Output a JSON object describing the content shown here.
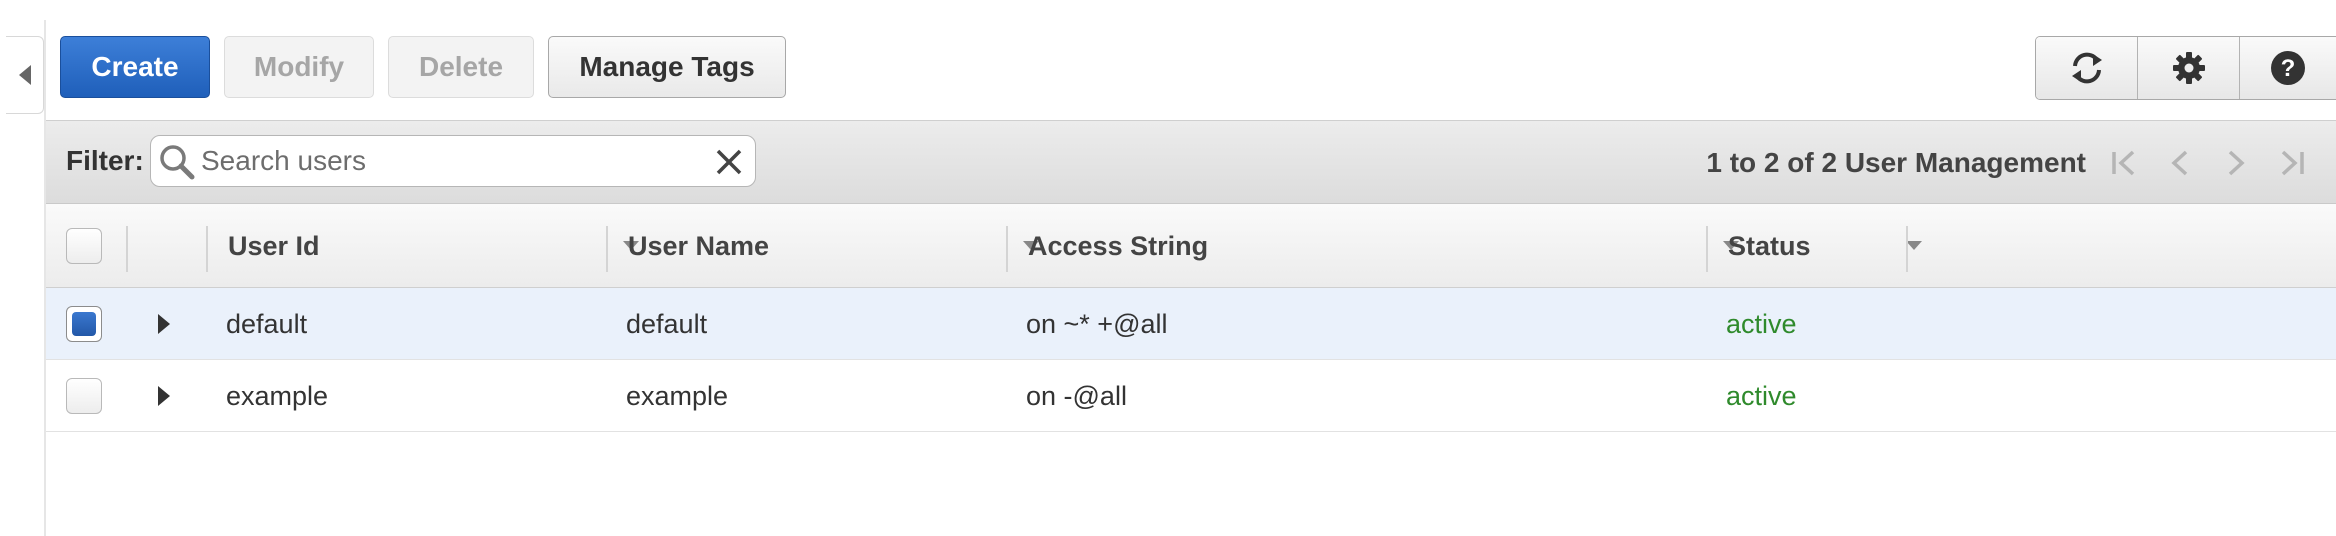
{
  "toolbar": {
    "create_label": "Create",
    "modify_label": "Modify",
    "delete_label": "Delete",
    "manage_tags_label": "Manage Tags",
    "icons": [
      "refresh-icon",
      "gear-icon",
      "help-icon"
    ]
  },
  "filter": {
    "label": "Filter:",
    "search_value": "",
    "search_placeholder": "Search users"
  },
  "pagination": {
    "summary": "1 to 2 of 2 User Management",
    "icons": [
      "first-page-icon",
      "previous-page-icon",
      "next-page-icon",
      "last-page-icon"
    ]
  },
  "table": {
    "columns": [
      "User Id",
      "User Name",
      "Access String",
      "Status"
    ],
    "rows": [
      {
        "selected": true,
        "user_id": "default",
        "user_name": "default",
        "access_string": "on ~* +@all",
        "status": "active"
      },
      {
        "selected": false,
        "user_id": "example",
        "user_name": "example",
        "access_string": "on -@all",
        "status": "active"
      }
    ]
  },
  "colors": {
    "primary": "#1f5fba",
    "status_active": "#2f8a2c",
    "selected_row": "#eaf1fb"
  }
}
